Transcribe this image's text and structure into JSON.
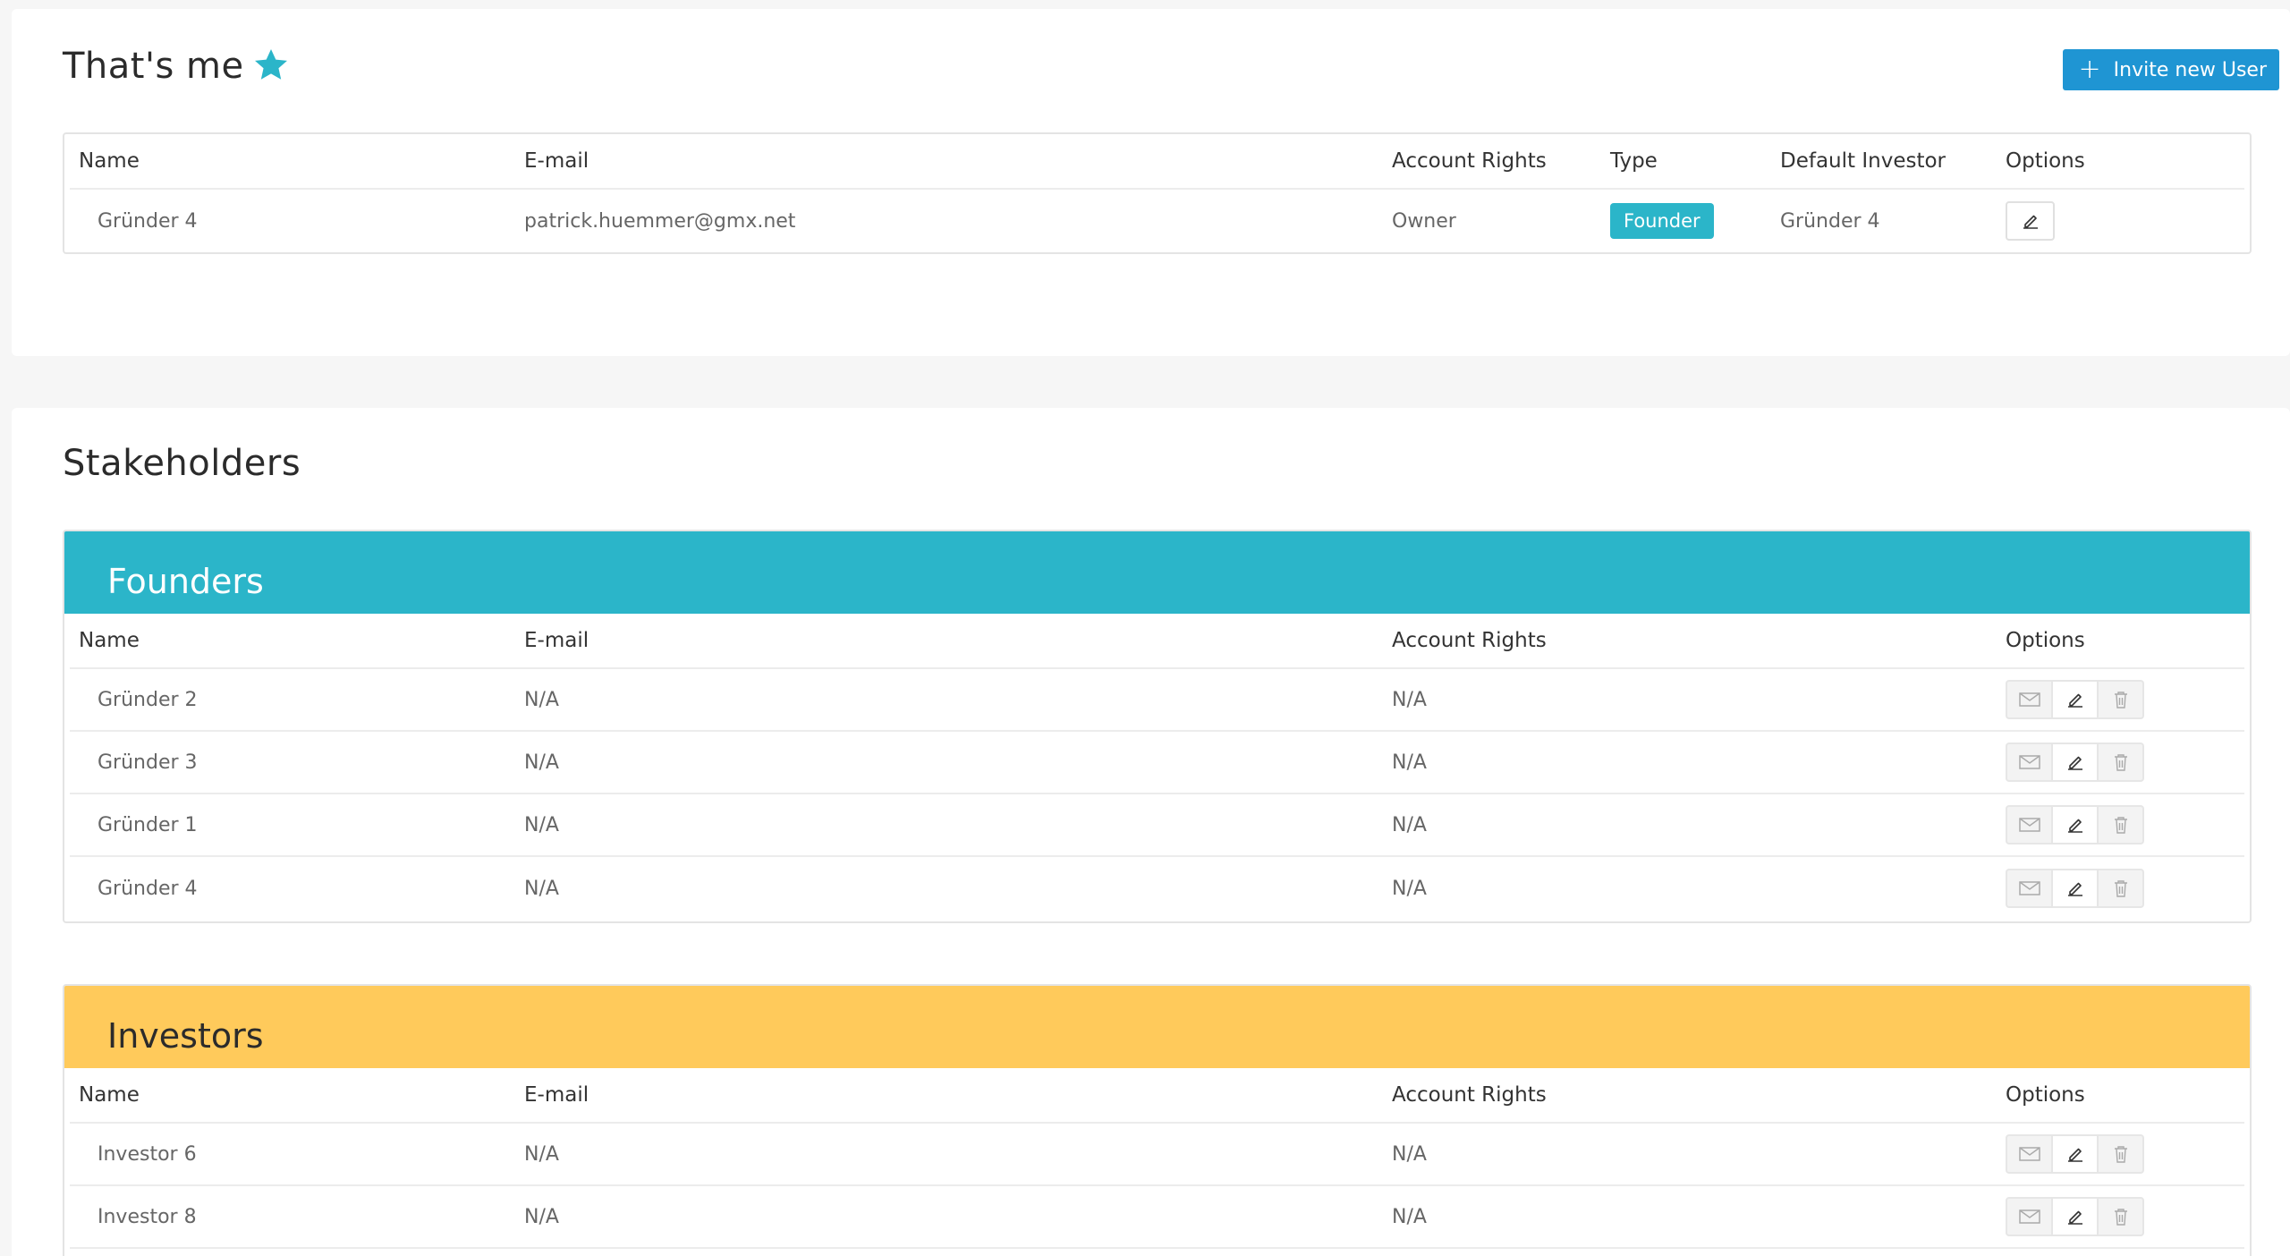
{
  "me": {
    "title": "That's me",
    "invite_label": "Invite new User",
    "columns": {
      "name": "Name",
      "email": "E-mail",
      "rights": "Account Rights",
      "type": "Type",
      "default_investor": "Default Investor",
      "options": "Options"
    },
    "row": {
      "name": "Gründer 4",
      "email": "patrick.huemmer@gmx.net",
      "rights": "Owner",
      "type": "Founder",
      "default_investor": "Gründer 4"
    }
  },
  "stakeholders": {
    "title": "Stakeholders",
    "founders": {
      "title": "Founders",
      "columns": {
        "name": "Name",
        "email": "E-mail",
        "rights": "Account Rights",
        "options": "Options"
      },
      "rows": [
        {
          "name": "Gründer 2",
          "email": "N/A",
          "rights": "N/A"
        },
        {
          "name": "Gründer 3",
          "email": "N/A",
          "rights": "N/A"
        },
        {
          "name": "Gründer 1",
          "email": "N/A",
          "rights": "N/A"
        },
        {
          "name": "Gründer 4",
          "email": "N/A",
          "rights": "N/A"
        }
      ]
    },
    "investors": {
      "title": "Investors",
      "columns": {
        "name": "Name",
        "email": "E-mail",
        "rights": "Account Rights",
        "options": "Options"
      },
      "rows": [
        {
          "name": "Investor 6",
          "email": "N/A",
          "rights": "N/A"
        },
        {
          "name": "Investor 8",
          "email": "N/A",
          "rights": "N/A"
        }
      ]
    }
  },
  "colors": {
    "founders_header": "#2bb5c9",
    "investors_header": "#ffca5b",
    "invite_button": "#1f95d3",
    "star": "#2bb5c9"
  },
  "icons": {
    "star": "star-icon",
    "plus": "plus-icon",
    "edit": "pencil-icon",
    "mail": "mail-icon",
    "delete": "trash-icon"
  }
}
